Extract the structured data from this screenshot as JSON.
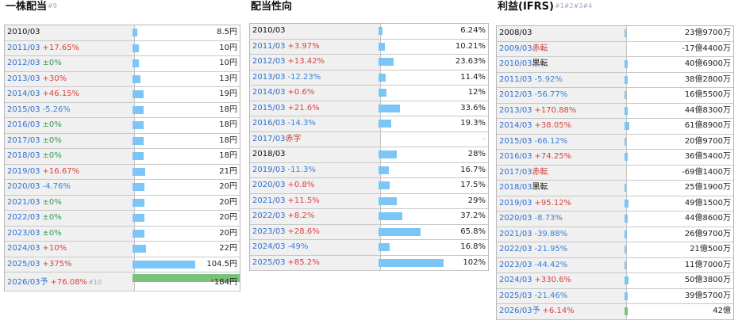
{
  "colors": {
    "bar": "#7cc6f7",
    "bar_estimate": "#7ac27c",
    "up": "#d9443e",
    "down": "#3a82d8",
    "flat": "#2f9a4f"
  },
  "chart_data": [
    {
      "type": "bar",
      "title": "一株配当",
      "title_note": "#9",
      "categories": [
        "2010/03",
        "2011/03",
        "2012/03",
        "2013/03",
        "2014/03",
        "2015/03",
        "2016/03",
        "2017/03",
        "2018/03",
        "2019/03",
        "2020/03",
        "2021/03",
        "2022/03",
        "2023/03",
        "2024/03",
        "2025/03",
        "2026/03予"
      ],
      "values": [
        8.5,
        10,
        10,
        13,
        19,
        18,
        18,
        18,
        18,
        21,
        20,
        20,
        20,
        20,
        22,
        104.5,
        184
      ],
      "unit": "円",
      "rows": [
        {
          "label": "2010/03",
          "change": "",
          "dir": "",
          "value": "8.5円",
          "num": 8.5
        },
        {
          "label": "2011/03",
          "change": "+17.65%",
          "dir": "up",
          "value": "10円",
          "num": 10
        },
        {
          "label": "2012/03",
          "change": "±0%",
          "dir": "flat",
          "value": "10円",
          "num": 10
        },
        {
          "label": "2013/03",
          "change": "+30%",
          "dir": "up",
          "value": "13円",
          "num": 13
        },
        {
          "label": "2014/03",
          "change": "+46.15%",
          "dir": "up",
          "value": "19円",
          "num": 19
        },
        {
          "label": "2015/03",
          "change": "-5.26%",
          "dir": "down",
          "value": "18円",
          "num": 18
        },
        {
          "label": "2016/03",
          "change": "±0%",
          "dir": "flat",
          "value": "18円",
          "num": 18
        },
        {
          "label": "2017/03",
          "change": "±0%",
          "dir": "flat",
          "value": "18円",
          "num": 18
        },
        {
          "label": "2018/03",
          "change": "±0%",
          "dir": "flat",
          "value": "18円",
          "num": 18
        },
        {
          "label": "2019/03",
          "change": "+16.67%",
          "dir": "up",
          "value": "21円",
          "num": 21
        },
        {
          "label": "2020/03",
          "change": "-4.76%",
          "dir": "down",
          "value": "20円",
          "num": 20
        },
        {
          "label": "2021/03",
          "change": "±0%",
          "dir": "flat",
          "value": "20円",
          "num": 20
        },
        {
          "label": "2022/03",
          "change": "±0%",
          "dir": "flat",
          "value": "20円",
          "num": 20
        },
        {
          "label": "2023/03",
          "change": "±0%",
          "dir": "flat",
          "value": "20円",
          "num": 20
        },
        {
          "label": "2024/03",
          "change": "+10%",
          "dir": "up",
          "value": "22円",
          "num": 22
        },
        {
          "label": "2025/03",
          "change": "+375%",
          "dir": "up",
          "value": "104.5円",
          "num": 104.5
        },
        {
          "label": "2026/03予",
          "change": "+76.08%",
          "dir": "up",
          "note": "#10",
          "value": "184円",
          "mark": "*",
          "num": 184,
          "estimate": true
        }
      ]
    },
    {
      "type": "bar",
      "title": "配当性向",
      "categories": [
        "2010/03",
        "2011/03",
        "2012/03",
        "2013/03",
        "2014/03",
        "2015/03",
        "2016/03",
        "2017/03",
        "2018/03",
        "2019/03",
        "2020/03",
        "2021/03",
        "2022/03",
        "2023/03",
        "2024/03",
        "2025/03"
      ],
      "values": [
        6.24,
        10.21,
        23.63,
        11.4,
        12,
        33.6,
        19.3,
        null,
        28,
        16.7,
        17.5,
        29,
        37.2,
        65.8,
        16.8,
        102
      ],
      "unit": "%",
      "rows": [
        {
          "label": "2010/03",
          "change": "",
          "dir": "",
          "value": "6.24%",
          "num": 6.24
        },
        {
          "label": "2011/03",
          "change": "+3.97%",
          "dir": "up",
          "value": "10.21%",
          "num": 10.21
        },
        {
          "label": "2012/03",
          "change": "+13.42%",
          "dir": "up",
          "value": "23.63%",
          "num": 23.63
        },
        {
          "label": "2013/03",
          "change": "-12.23%",
          "dir": "down",
          "value": "11.4%",
          "num": 11.4
        },
        {
          "label": "2014/03",
          "change": "+0.6%",
          "dir": "up",
          "value": "12%",
          "num": 12
        },
        {
          "label": "2015/03",
          "change": "+21.6%",
          "dir": "up",
          "value": "33.6%",
          "num": 33.6
        },
        {
          "label": "2016/03",
          "change": "-14.3%",
          "dir": "down",
          "value": "19.3%",
          "num": 19.3
        },
        {
          "label": "2017/03",
          "change": "赤字",
          "dir": "red",
          "value": "-",
          "num": null,
          "muted": true
        },
        {
          "label": "2018/03",
          "change": "",
          "dir": "",
          "value": "28%",
          "num": 28
        },
        {
          "label": "2019/03",
          "change": "-11.3%",
          "dir": "down",
          "value": "16.7%",
          "num": 16.7
        },
        {
          "label": "2020/03",
          "change": "+0.8%",
          "dir": "up",
          "value": "17.5%",
          "num": 17.5
        },
        {
          "label": "2021/03",
          "change": "+11.5%",
          "dir": "up",
          "value": "29%",
          "num": 29
        },
        {
          "label": "2022/03",
          "change": "+8.2%",
          "dir": "up",
          "value": "37.2%",
          "num": 37.2
        },
        {
          "label": "2023/03",
          "change": "+28.6%",
          "dir": "up",
          "value": "65.8%",
          "num": 65.8
        },
        {
          "label": "2024/03",
          "change": "-49%",
          "dir": "down",
          "value": "16.8%",
          "num": 16.8
        },
        {
          "label": "2025/03",
          "change": "+85.2%",
          "dir": "up",
          "value": "102%",
          "num": 102
        }
      ]
    },
    {
      "type": "bar",
      "title": "利益(IFRS)",
      "title_note": "#1#2#3#4",
      "categories": [
        "2008/03",
        "2009/03",
        "2010/03",
        "2011/03",
        "2012/03",
        "2013/03",
        "2014/03",
        "2015/03",
        "2016/03",
        "2017/03",
        "2018/03",
        "2019/03",
        "2020/03",
        "2021/03",
        "2022/03",
        "2023/03",
        "2024/03",
        "2025/03",
        "2026/03予"
      ],
      "values": [
        23.97,
        -17.44,
        40.69,
        38.28,
        16.55,
        44.83,
        61.89,
        20.97,
        36.54,
        -69.14,
        25.19,
        49.15,
        44.86,
        26.97,
        21.05,
        11.7,
        50.38,
        39.57,
        42
      ],
      "unit": "億",
      "rows": [
        {
          "label": "2008/03",
          "change": "",
          "dir": "",
          "value": "23億9700万",
          "num": 23.97,
          "plain": true
        },
        {
          "label": "2009/03",
          "change": "赤転",
          "dir": "red",
          "value": "-17億4400万",
          "num": -17.44
        },
        {
          "label": "2010/03",
          "change": "黒転",
          "dir": "blk",
          "value": "40億6900万",
          "num": 40.69
        },
        {
          "label": "2011/03",
          "change": "-5.92%",
          "dir": "down",
          "value": "38億2800万",
          "num": 38.28
        },
        {
          "label": "2012/03",
          "change": "-56.77%",
          "dir": "down",
          "value": "16億5500万",
          "num": 16.55
        },
        {
          "label": "2013/03",
          "change": "+170.88%",
          "dir": "up",
          "value": "44億8300万",
          "num": 44.83
        },
        {
          "label": "2014/03",
          "change": "+38.05%",
          "dir": "up",
          "value": "61億8900万",
          "num": 61.89
        },
        {
          "label": "2015/03",
          "change": "-66.12%",
          "dir": "down",
          "value": "20億9700万",
          "num": 20.97
        },
        {
          "label": "2016/03",
          "change": "+74.25%",
          "dir": "up",
          "value": "36億5400万",
          "num": 36.54
        },
        {
          "label": "2017/03",
          "change": "赤転",
          "dir": "red",
          "value": "-69億1400万",
          "num": -69.14
        },
        {
          "label": "2018/03",
          "change": "黒転",
          "dir": "blk",
          "value": "25億1900万",
          "num": 25.19
        },
        {
          "label": "2019/03",
          "change": "+95.12%",
          "dir": "up",
          "value": "49億1500万",
          "num": 49.15
        },
        {
          "label": "2020/03",
          "change": "-8.73%",
          "dir": "down",
          "value": "44億8600万",
          "num": 44.86
        },
        {
          "label": "2021/03",
          "change": "-39.88%",
          "dir": "down",
          "value": "26億9700万",
          "num": 26.97
        },
        {
          "label": "2022/03",
          "change": "-21.95%",
          "dir": "down",
          "value": "21億500万",
          "num": 21.05
        },
        {
          "label": "2023/03",
          "change": "-44.42%",
          "dir": "down",
          "value": "11億7000万",
          "num": 11.7
        },
        {
          "label": "2024/03",
          "change": "+330.6%",
          "dir": "up",
          "value": "50億3800万",
          "num": 50.38
        },
        {
          "label": "2025/03",
          "change": "-21.46%",
          "dir": "down",
          "value": "39億5700万",
          "num": 39.57
        },
        {
          "label": "2026/03予",
          "change": "+6.14%",
          "dir": "up",
          "value": "42億",
          "num": 42,
          "estimate": true
        }
      ]
    }
  ]
}
